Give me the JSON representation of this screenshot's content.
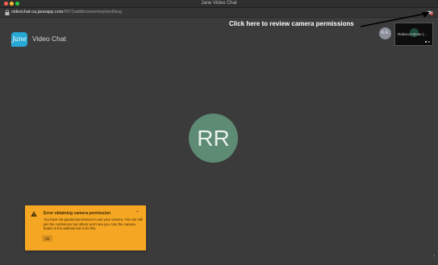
{
  "window": {
    "title": "Jane Video Chat"
  },
  "address_bar": {
    "host": "videochat-ca.janeapp.com",
    "path": "/6971addbrowneelephantfang"
  },
  "brand": {
    "logo_text": "Jane",
    "app_name": "Video Chat"
  },
  "annotation": {
    "text": "Click here to review camera permissions"
  },
  "participants": {
    "remote_initials": "RR",
    "small_avatar_initials": "R.R.",
    "self_view_name": "Rebecca Rose (..."
  },
  "notice": {
    "title": "Error obtaining camera permission",
    "body": "You have not granted permission to use your camera. You can still join the conference but others won't see you. Use the camera button in the address bar to fix this.",
    "ok_label": "Ok"
  },
  "icons": {
    "lock": "lock-icon",
    "camera_blocked": "camera-blocked-icon",
    "warning": "warning-icon",
    "collapse": "chevron-up-icon",
    "expand": "chevron-right-icon"
  },
  "colors": {
    "background": "#3a3a3a",
    "brand_blue": "#28a8d4",
    "avatar_green": "#5e8b74",
    "notice_orange": "#f5a623",
    "blocked_red": "#e0352b"
  }
}
